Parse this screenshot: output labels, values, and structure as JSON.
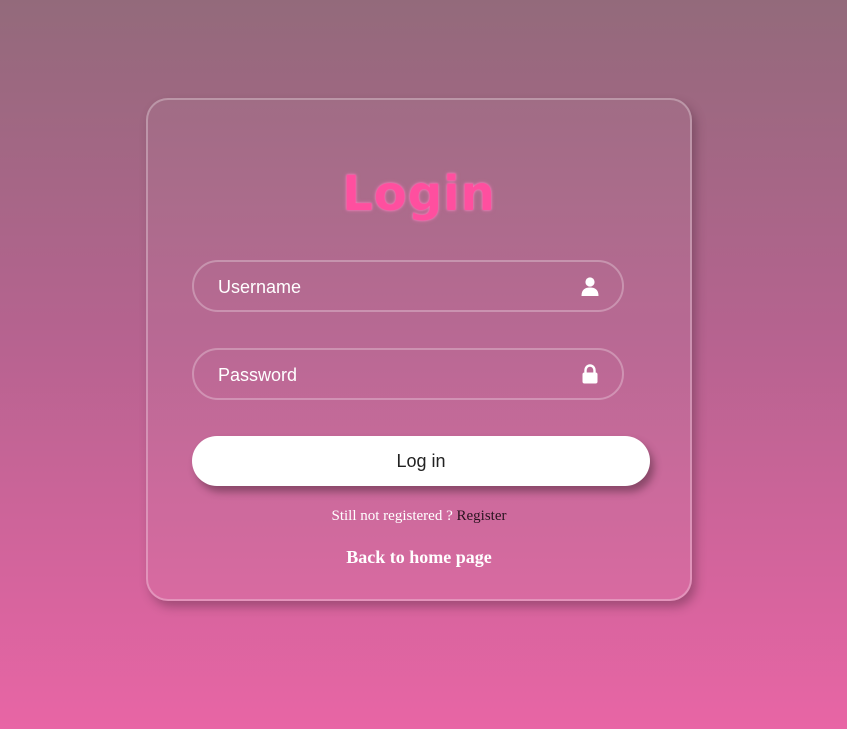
{
  "login_form": {
    "title": "Login",
    "username": {
      "placeholder": "Username",
      "value": "",
      "icon": "user-icon"
    },
    "password": {
      "placeholder": "Password",
      "value": "",
      "icon": "lock-icon"
    },
    "submit_label": "Log in",
    "register_prompt": "Still not registered ?",
    "register_link": "Register",
    "home_link": "Back to home page"
  },
  "colors": {
    "title": "#ff4f9f",
    "background_top": "#936a7b",
    "background_bottom": "#e865a5",
    "button_bg": "#ffffff",
    "register_link": "#2a1420"
  }
}
